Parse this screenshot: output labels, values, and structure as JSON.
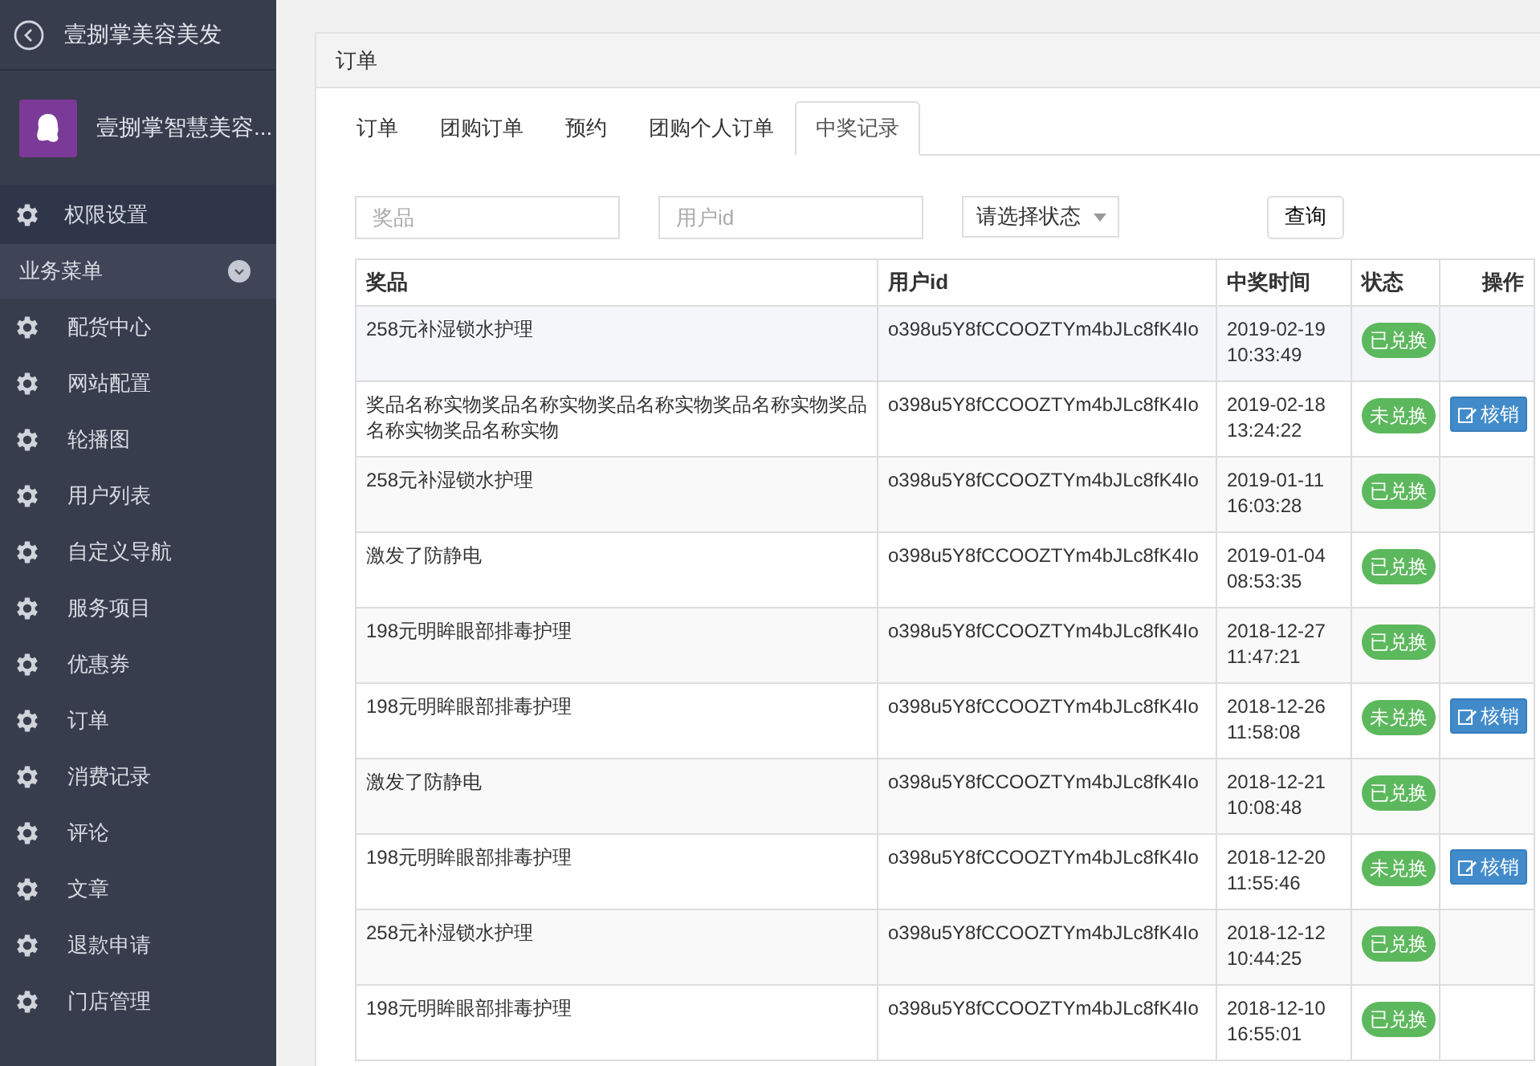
{
  "sidebar": {
    "back_title": "壹捌掌美容美发",
    "brand": "壹捌掌智慧美容...",
    "top_item": "权限设置",
    "section": {
      "label": "业务菜单",
      "expanded": true
    },
    "items": [
      "配货中心",
      "网站配置",
      "轮播图",
      "用户列表",
      "自定义导航",
      "服务项目",
      "优惠券",
      "订单",
      "消费记录",
      "评论",
      "文章",
      "退款申请",
      "门店管理"
    ]
  },
  "panel": {
    "title": "订单",
    "tabs": [
      {
        "label": "订单",
        "selected": false
      },
      {
        "label": "团购订单",
        "selected": false
      },
      {
        "label": "预约",
        "selected": false
      },
      {
        "label": "团购个人订单",
        "selected": false
      },
      {
        "label": "中奖记录",
        "selected": true
      }
    ],
    "filters": {
      "prize_placeholder": "奖品",
      "user_placeholder": "用户id",
      "status_select": "请选择状态",
      "query_button": "查询"
    },
    "table": {
      "columns": [
        "奖品",
        "用户id",
        "中奖时间",
        "状态",
        "操作"
      ],
      "rows": [
        {
          "prize": "258元补湿锁水护理",
          "user": "o398u5Y8fCCOOZTYm4bJLc8fK4Io",
          "date": "2019-02-19",
          "time": "10:33:49",
          "status": "已兑换"
        },
        {
          "prize": "奖品名称实物奖品名称实物奖品名称实物奖品名称实物奖品名称实物奖品名称实物",
          "user": "o398u5Y8fCCOOZTYm4bJLc8fK4Io",
          "date": "2019-02-18",
          "time": "13:24:22",
          "status": "未兑换",
          "action": "核销"
        },
        {
          "prize": "258元补湿锁水护理",
          "user": "o398u5Y8fCCOOZTYm4bJLc8fK4Io",
          "date": "2019-01-11",
          "time": "16:03:28",
          "status": "已兑换"
        },
        {
          "prize": "激发了防静电",
          "user": "o398u5Y8fCCOOZTYm4bJLc8fK4Io",
          "date": "2019-01-04",
          "time": "08:53:35",
          "status": "已兑换"
        },
        {
          "prize": "198元明眸眼部排毒护理",
          "user": "o398u5Y8fCCOOZTYm4bJLc8fK4Io",
          "date": "2018-12-27",
          "time": "11:47:21",
          "status": "已兑换"
        },
        {
          "prize": "198元明眸眼部排毒护理",
          "user": "o398u5Y8fCCOOZTYm4bJLc8fK4Io",
          "date": "2018-12-26",
          "time": "11:58:08",
          "status": "未兑换",
          "action": "核销"
        },
        {
          "prize": "激发了防静电",
          "user": "o398u5Y8fCCOOZTYm4bJLc8fK4Io",
          "date": "2018-12-21",
          "time": "10:08:48",
          "status": "已兑换"
        },
        {
          "prize": "198元明眸眼部排毒护理",
          "user": "o398u5Y8fCCOOZTYm4bJLc8fK4Io",
          "date": "2018-12-20",
          "time": "11:55:46",
          "status": "未兑换",
          "action": "核销"
        },
        {
          "prize": "258元补湿锁水护理",
          "user": "o398u5Y8fCCOOZTYm4bJLc8fK4Io",
          "date": "2018-12-12",
          "time": "10:44:25",
          "status": "已兑换"
        },
        {
          "prize": "198元明眸眼部排毒护理",
          "user": "o398u5Y8fCCOOZTYm4bJLc8fK4Io",
          "date": "2018-12-10",
          "time": "16:55:01",
          "status": "已兑换"
        }
      ]
    }
  }
}
